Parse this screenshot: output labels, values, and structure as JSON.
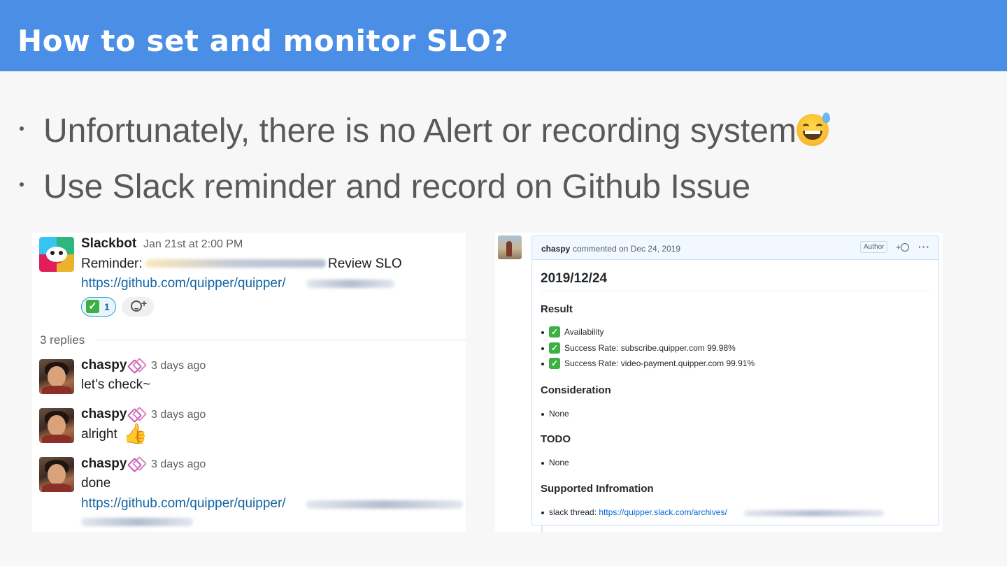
{
  "slide": {
    "title": "How to set and monitor SLO?",
    "bullets": [
      "Unfortunately, there is no Alert or recording system",
      "Use Slack reminder and record on Github Issue"
    ]
  },
  "slack": {
    "bot": {
      "name": "Slackbot",
      "time": "Jan 21st at 2:00 PM",
      "reminder_prefix": "Reminder:",
      "reminder_suffix": "Review SLO",
      "link": "https://github.com/quipper/quipper/",
      "reaction_count": "1"
    },
    "replies_label": "3 replies",
    "messages": [
      {
        "user": "chaspy",
        "time": "3 days ago",
        "text": "let's check~"
      },
      {
        "user": "chaspy",
        "time": "3 days ago",
        "text": "alright"
      },
      {
        "user": "chaspy",
        "time": "3 days ago",
        "text": "done",
        "link": "https://github.com/quipper/quipper/"
      }
    ]
  },
  "github": {
    "author": "chaspy",
    "commented": "commented on Dec 24, 2019",
    "author_badge": "Author",
    "emoji_button": "+",
    "more": "···",
    "heading": "2019/12/24",
    "sections": [
      {
        "title": "Result",
        "items": [
          {
            "check": true,
            "text": "Availability"
          },
          {
            "check": true,
            "text": "Success Rate: subscribe.quipper.com 99.98%"
          },
          {
            "check": true,
            "text": "Success Rate: video-payment.quipper.com 99.91%"
          }
        ]
      },
      {
        "title": "Consideration",
        "items": [
          {
            "text": "None"
          }
        ]
      },
      {
        "title": "TODO",
        "items": [
          {
            "text": "None"
          }
        ]
      },
      {
        "title": "Supported Infromation",
        "items": [
          {
            "prefix": "slack thread: ",
            "link": "https://quipper.slack.com/archives/"
          }
        ]
      }
    ]
  },
  "colors": {
    "title_bar": "#4a8ee6",
    "slack_link": "#1264a3",
    "github_link": "#0366d6",
    "check_green": "#3cb043"
  }
}
